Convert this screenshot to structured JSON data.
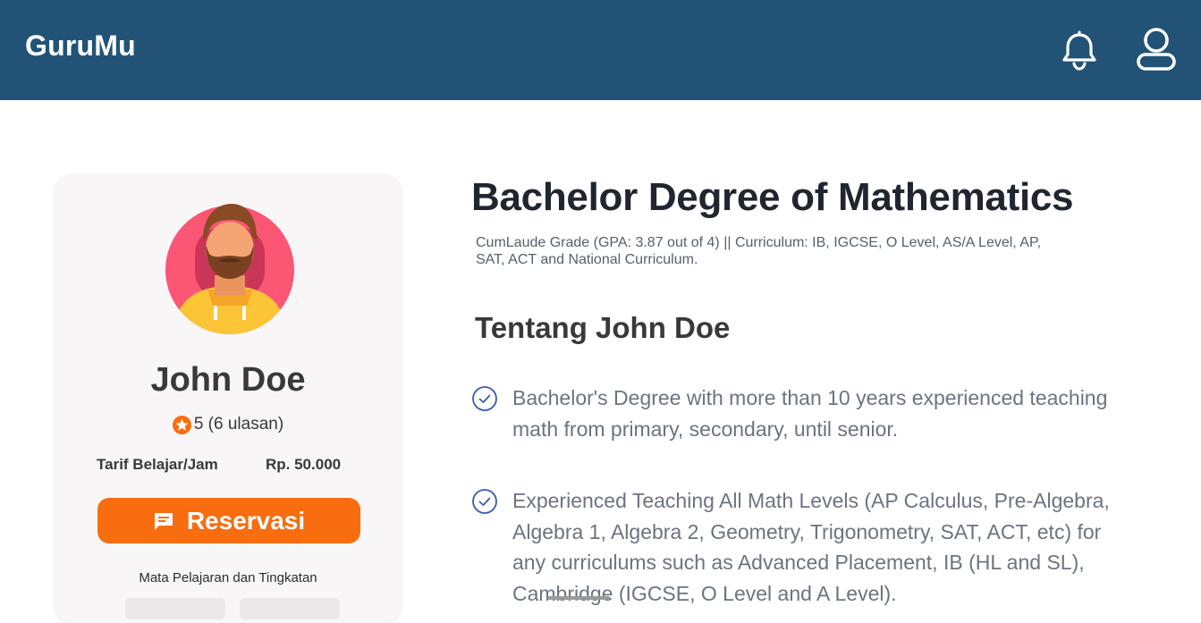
{
  "header": {
    "brand": "GuruMu",
    "notification_icon": "bell-icon",
    "profile_icon": "user-icon",
    "background": "#225377"
  },
  "tutor_card": {
    "name": "John Doe",
    "rating_icon": "star-icon",
    "rating_text": "5 (6 ulasan)",
    "rate_label": "Tarif Belajar/Jam",
    "rate_value": "Rp. 50.000",
    "reserve_label": "Reservasi",
    "reserve_icon": "chat-icon",
    "subjects_title": "Mata Pelajaran dan Tingkatan",
    "accent": "#f86d10"
  },
  "main": {
    "degree_title": "Bachelor Degree of Mathematics",
    "subtitle": "CumLaude Grade (GPA: 3.87 out of 4) ||  Curriculum: IB, IGCSE, O Level, AS/A Level, AP, SAT, ACT and National Curriculum.",
    "about_title": "Tentang John Doe",
    "bullet_icon": "check-circle-icon",
    "bullets": [
      "Bachelor's Degree with more than 10 years experienced teaching math from primary, secondary, until senior.",
      "Experienced Teaching All Math Levels (AP Calculus, Pre-Algebra, Algebra 1, Algebra 2, Geometry, Trigonometry, SAT, ACT, etc) for any curriculums such as Advanced Placement, IB (HL and SL), Cambridge (IGCSE, O Level and A Level)."
    ]
  }
}
